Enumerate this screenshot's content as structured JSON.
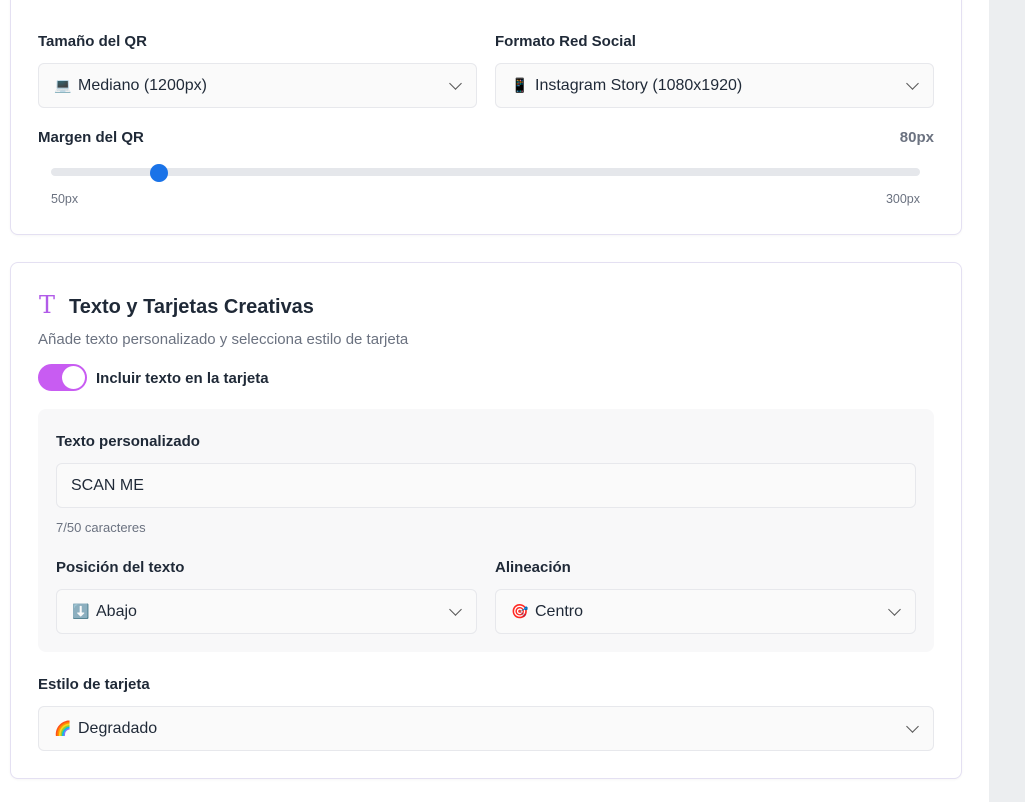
{
  "qr_settings": {
    "size": {
      "label": "Tamaño del QR",
      "icon": "laptop-icon",
      "emoji": "💻",
      "value": "Mediano (1200px)"
    },
    "social_format": {
      "label": "Formato Red Social",
      "icon": "mobile-phone-icon",
      "emoji": "📱",
      "value": "Instagram Story (1080x1920)"
    },
    "margin": {
      "label": "Margen del QR",
      "value_text": "80px",
      "value": 80,
      "min_label": "50px",
      "max_label": "300px",
      "min": 50,
      "max": 300
    }
  },
  "text_section": {
    "icon": "text-type-icon",
    "icon_glyph": "T",
    "title": "Texto y Tarjetas Creativas",
    "subtitle": "Añade texto personalizado y selecciona estilo de tarjeta",
    "toggle": {
      "label": "Incluir texto en la tarjeta",
      "on": true
    },
    "custom_text": {
      "label": "Texto personalizado",
      "value": "SCAN ME",
      "counter": "7/50 caracteres"
    },
    "position": {
      "label": "Posición del texto",
      "icon": "down-arrow-icon",
      "emoji": "⬇️",
      "value": "Abajo"
    },
    "alignment": {
      "label": "Alineación",
      "icon": "target-icon",
      "emoji": "🎯",
      "value": "Centro"
    },
    "card_style": {
      "label": "Estilo de tarjeta",
      "icon": "rainbow-icon",
      "emoji": "🌈",
      "value": "Degradado"
    }
  },
  "colors": {
    "accent": "#c85cf2",
    "slider_thumb": "#1a73e8",
    "card_border": "#e4e0f2"
  }
}
